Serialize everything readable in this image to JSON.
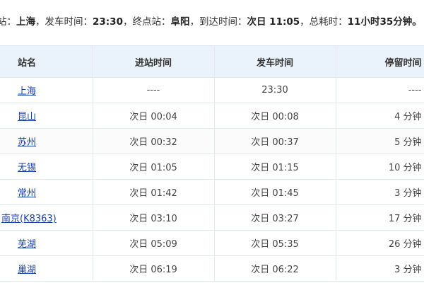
{
  "summary": {
    "start_label": "站：",
    "start_value": "上海",
    "depart_label": "，发车时间：",
    "depart_value": "23:30",
    "end_label": "，终点站：",
    "end_value": "阜阳",
    "arrive_label": "，到达时间：",
    "arrive_value": "次日 11:05",
    "total_label": "，总耗时：",
    "total_value": "11小时35分钟。"
  },
  "table": {
    "headers": {
      "station": "站名",
      "arrive": "进站时间",
      "depart": "发车时间",
      "stop": "停留时间"
    },
    "rows": [
      {
        "station": "上海",
        "arrive": "----",
        "depart": "23:30",
        "stop": "----"
      },
      {
        "station": "昆山",
        "arrive": "次日 00:04",
        "depart": "次日 00:08",
        "stop": "4 分钟"
      },
      {
        "station": "苏州",
        "arrive": "次日 00:32",
        "depart": "次日 00:37",
        "stop": "5 分钟"
      },
      {
        "station": "无锡",
        "arrive": "次日 01:05",
        "depart": "次日 01:15",
        "stop": "10 分钟"
      },
      {
        "station": "常州",
        "arrive": "次日 01:42",
        "depart": "次日 01:45",
        "stop": "3 分钟"
      },
      {
        "station": "南京(K8363)",
        "arrive": "次日 03:10",
        "depart": "次日 03:27",
        "stop": "17 分钟"
      },
      {
        "station": "芜湖",
        "arrive": "次日 05:09",
        "depart": "次日 05:35",
        "stop": "26 分钟"
      },
      {
        "station": "巢湖",
        "arrive": "次日 06:19",
        "depart": "次日 06:22",
        "stop": "3 分钟"
      }
    ]
  },
  "colors": {
    "header_bg": "#eaf2fb",
    "link": "#1a3ea8",
    "border": "#e3e8ef"
  }
}
